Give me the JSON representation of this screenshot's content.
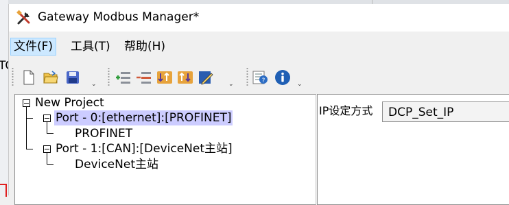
{
  "window": {
    "title": "Gateway Modbus Manager*"
  },
  "background": {
    "left_fragment": "TC"
  },
  "menu": [
    {
      "label": "文件(F)",
      "active": true
    },
    {
      "label": "工具(T)",
      "active": false
    },
    {
      "label": "帮助(H)",
      "active": false
    }
  ],
  "toolbar": {
    "file_group": [
      "new-file-icon",
      "open-folder-icon",
      "save-icon"
    ],
    "edit_group": [
      "add-port-icon",
      "remove-port-icon",
      "import-icon",
      "export-icon",
      "edit-icon"
    ],
    "help_group": [
      "help-icon",
      "info-icon"
    ],
    "overflow_glyph": "⌄"
  },
  "tree": {
    "root": "New Project",
    "ports": [
      {
        "label": "Port - 0:[ethernet]:[PROFINET]",
        "selected": true,
        "child": "PROFINET"
      },
      {
        "label": "Port - 1:[CAN]:[DeviceNet主站]",
        "selected": false,
        "child": "DeviceNet主站"
      }
    ]
  },
  "properties": {
    "ip_mode_label": "IP设定方式",
    "ip_mode_value": "DCP_Set_IP"
  },
  "colors": {
    "selection": "#ccccff",
    "menu_active": "#cce8ff",
    "accent": "#0078d7"
  }
}
